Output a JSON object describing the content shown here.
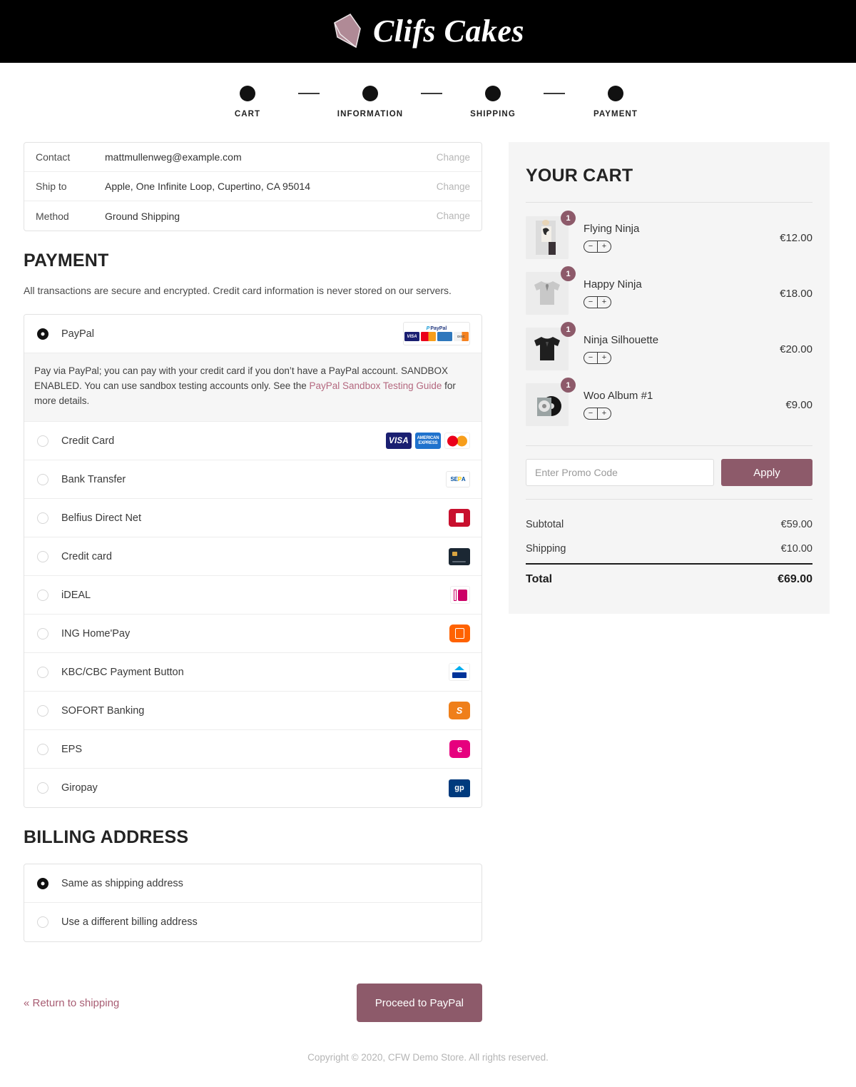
{
  "brand": {
    "name": "Clifs Cakes",
    "logo_icon": "cake-slice-icon",
    "logo_color": "#b08a96"
  },
  "steps": [
    {
      "label": "CART"
    },
    {
      "label": "INFORMATION"
    },
    {
      "label": "SHIPPING"
    },
    {
      "label": "PAYMENT"
    }
  ],
  "summary": {
    "rows": [
      {
        "key": "Contact",
        "value": "mattmullenweg@example.com",
        "action": "Change"
      },
      {
        "key": "Ship to",
        "value": "Apple, One Infinite Loop, Cupertino, CA 95014",
        "action": "Change"
      },
      {
        "key": "Method",
        "value": "Ground Shipping",
        "action": "Change"
      }
    ]
  },
  "payment": {
    "title": "PAYMENT",
    "description": "All transactions are secure and encrypted. Credit card information is never stored on our servers.",
    "paypal": {
      "label": "PayPal",
      "selected": true,
      "icon": "paypal-cards-badge",
      "desc_before": "Pay via PayPal; you can pay with your credit card if you don’t have a PayPal account. SANDBOX ENABLED. You can use sandbox testing accounts only. See the ",
      "desc_link": "PayPal Sandbox Testing Guide",
      "desc_after": " for more details."
    },
    "methods": [
      {
        "label": "Credit Card",
        "icon": "visa-amex-mastercard-icons",
        "selected": false
      },
      {
        "label": "Bank Transfer",
        "icon": "sepa-icon",
        "selected": false
      },
      {
        "label": "Belfius Direct Net",
        "icon": "belfius-icon",
        "selected": false
      },
      {
        "label": "Credit card",
        "icon": "credit-card-icon",
        "selected": false
      },
      {
        "label": "iDEAL",
        "icon": "ideal-icon",
        "selected": false
      },
      {
        "label": "ING Home'Pay",
        "icon": "ing-icon",
        "selected": false
      },
      {
        "label": "KBC/CBC Payment Button",
        "icon": "kbc-cbc-icon",
        "selected": false
      },
      {
        "label": "SOFORT Banking",
        "icon": "sofort-icon",
        "selected": false
      },
      {
        "label": "EPS",
        "icon": "eps-icon",
        "selected": false
      },
      {
        "label": "Giropay",
        "icon": "giropay-icon",
        "selected": false
      }
    ]
  },
  "billing": {
    "title": "BILLING ADDRESS",
    "options": [
      {
        "label": "Same as shipping address",
        "selected": true
      },
      {
        "label": "Use a different billing address",
        "selected": false
      }
    ]
  },
  "actions": {
    "return_label": "« Return to shipping",
    "submit_label": "Proceed to PayPal",
    "accent_color": "#8d5a6a"
  },
  "cart": {
    "title": "YOUR CART",
    "items": [
      {
        "name": "Flying Ninja",
        "qty": "1",
        "price": "€12.00",
        "thumb": "tshirt-model-photo"
      },
      {
        "name": "Happy Ninja",
        "qty": "1",
        "price": "€18.00",
        "thumb": "gray-tshirt-photo"
      },
      {
        "name": "Ninja Silhouette",
        "qty": "1",
        "price": "€20.00",
        "thumb": "black-tshirt-photo"
      },
      {
        "name": "Woo Album #1",
        "qty": "1",
        "price": "€9.00",
        "thumb": "vinyl-record-photo"
      }
    ],
    "stepper": {
      "decrease": "−",
      "increase": "+"
    },
    "promo": {
      "placeholder": "Enter Promo Code",
      "value": "",
      "apply_label": "Apply"
    },
    "totals": [
      {
        "label": "Subtotal",
        "value": "€59.00"
      },
      {
        "label": "Shipping",
        "value": "€10.00"
      }
    ],
    "grand_total": {
      "label": "Total",
      "value": "€69.00"
    }
  },
  "footer": {
    "copyright": "Copyright © 2020, CFW Demo Store. All rights reserved."
  }
}
